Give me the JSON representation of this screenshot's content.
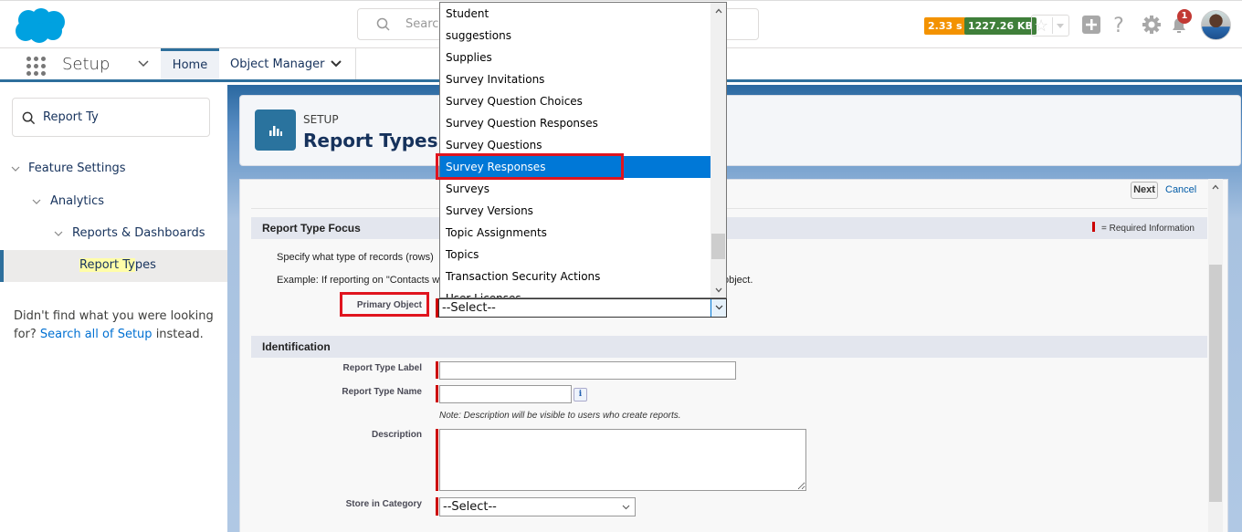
{
  "header": {
    "search_placeholder": "Search...",
    "perf_time": "2.33 s",
    "perf_size": "1227.26 KB",
    "notification_count": "1",
    "colors": {
      "time_badge": "#f39200",
      "size_badge": "#3f7f3a",
      "brand": "#00a1e0"
    }
  },
  "nav": {
    "app_name": "Setup",
    "tabs": [
      {
        "label": "Home",
        "active": true
      },
      {
        "label": "Object Manager",
        "active": false
      }
    ]
  },
  "sidebar": {
    "search_value": "Report Ty",
    "tree": [
      {
        "label": "Feature Settings",
        "level": 0,
        "expanded": true
      },
      {
        "label": "Analytics",
        "level": 1,
        "expanded": true
      },
      {
        "label": "Reports & Dashboards",
        "level": 2,
        "expanded": true
      }
    ],
    "active_item": {
      "label_highlight": "Report Ty",
      "label_rest": "pes"
    },
    "not_found_prefix": "Didn't find what you were looking for?",
    "not_found_link": "Search all of Setup",
    "not_found_suffix": "instead."
  },
  "page_header": {
    "eyebrow": "SETUP",
    "title": "Report Types"
  },
  "form": {
    "next_label": "Next",
    "cancel_label": "Cancel",
    "focus_section": {
      "title": "Report Type Focus",
      "required_legend": "= Required Information",
      "text1": "Specify what type of records (rows)",
      "text1_tail": "",
      "text2": "Example: If reporting on \"Contacts wi",
      "text2_tail": "object.",
      "primary_object_label": "Primary Object",
      "primary_object_value": "--Select--"
    },
    "identification_section": {
      "title": "Identification",
      "report_type_label_label": "Report Type Label",
      "report_type_label_value": "",
      "report_type_name_label": "Report Type Name",
      "report_type_name_value": "",
      "info_icon": "i",
      "note": "Note: Description will be visible to users who create reports.",
      "description_label": "Description",
      "description_value": "",
      "category_label": "Store in Category",
      "category_value": "--Select--"
    }
  },
  "dropdown": {
    "options": [
      "Student",
      "suggestions",
      "Supplies",
      "Survey Invitations",
      "Survey Question Choices",
      "Survey Question Responses",
      "Survey Questions",
      "Survey Responses",
      "Surveys",
      "Survey Versions",
      "Topic Assignments",
      "Topics",
      "Transaction Security Actions",
      "User Licenses"
    ],
    "selected": "Survey Responses"
  }
}
